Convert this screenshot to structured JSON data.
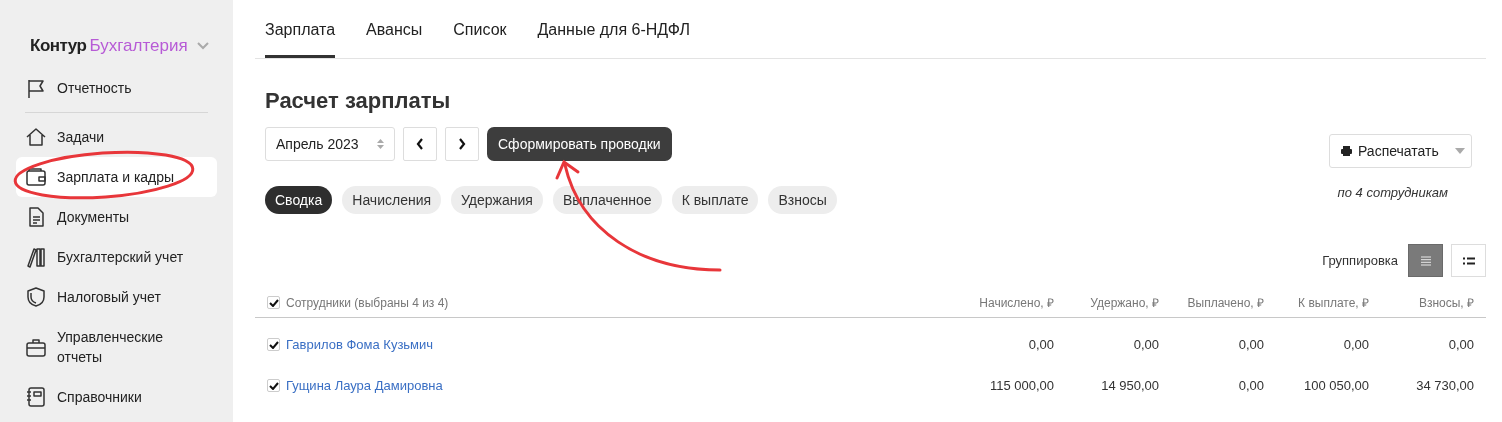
{
  "brand": {
    "name": "Контур",
    "product": "Бухгалтерия"
  },
  "sidebar": {
    "items": [
      {
        "label": "Отчетность",
        "selected": false
      },
      {
        "label": "Задачи",
        "selected": false
      },
      {
        "label": "Зарплата и кадры",
        "selected": true
      },
      {
        "label": "Документы",
        "selected": false
      },
      {
        "label": "Бухгалтерский учет",
        "selected": false
      },
      {
        "label": "Налоговый учет",
        "selected": false
      },
      {
        "label": "Управленческие отчеты",
        "selected": false
      },
      {
        "label": "Справочники",
        "selected": false
      }
    ]
  },
  "tabs": [
    {
      "label": "Зарплата",
      "selected": true
    },
    {
      "label": "Авансы",
      "selected": false
    },
    {
      "label": "Список",
      "selected": false
    },
    {
      "label": "Данные для 6-НДФЛ",
      "selected": false
    }
  ],
  "title": "Расчет зарплаты",
  "period": {
    "value": "Апрель 2023"
  },
  "action_button": "Сформировать проводки",
  "filters": [
    {
      "label": "Сводка",
      "selected": true
    },
    {
      "label": "Начисления",
      "selected": false
    },
    {
      "label": "Удержания",
      "selected": false
    },
    {
      "label": "Выплаченное",
      "selected": false
    },
    {
      "label": "К выплате",
      "selected": false
    },
    {
      "label": "Взносы",
      "selected": false
    }
  ],
  "print_button": "Распечатать",
  "print_note": "по 4 сотрудникам",
  "grouping": {
    "label": "Группировка",
    "options": [
      {
        "selected": true
      },
      {
        "selected": false
      }
    ]
  },
  "table": {
    "select_all_checked": true,
    "columns": [
      "Сотрудники (выбраны 4 из 4)",
      "Начислено, ₽",
      "Удержано, ₽",
      "Выплачено, ₽",
      "К выплате, ₽",
      "Взносы, ₽"
    ],
    "rows": [
      {
        "checked": true,
        "name": "Гаврилов Фома Кузьмич",
        "values": [
          "0,00",
          "0,00",
          "0,00",
          "0,00",
          "0,00"
        ]
      },
      {
        "checked": true,
        "name": "Гущина Лаура Дамировна",
        "values": [
          "115 000,00",
          "14 950,00",
          "0,00",
          "100 050,00",
          "34 730,00"
        ]
      }
    ]
  }
}
